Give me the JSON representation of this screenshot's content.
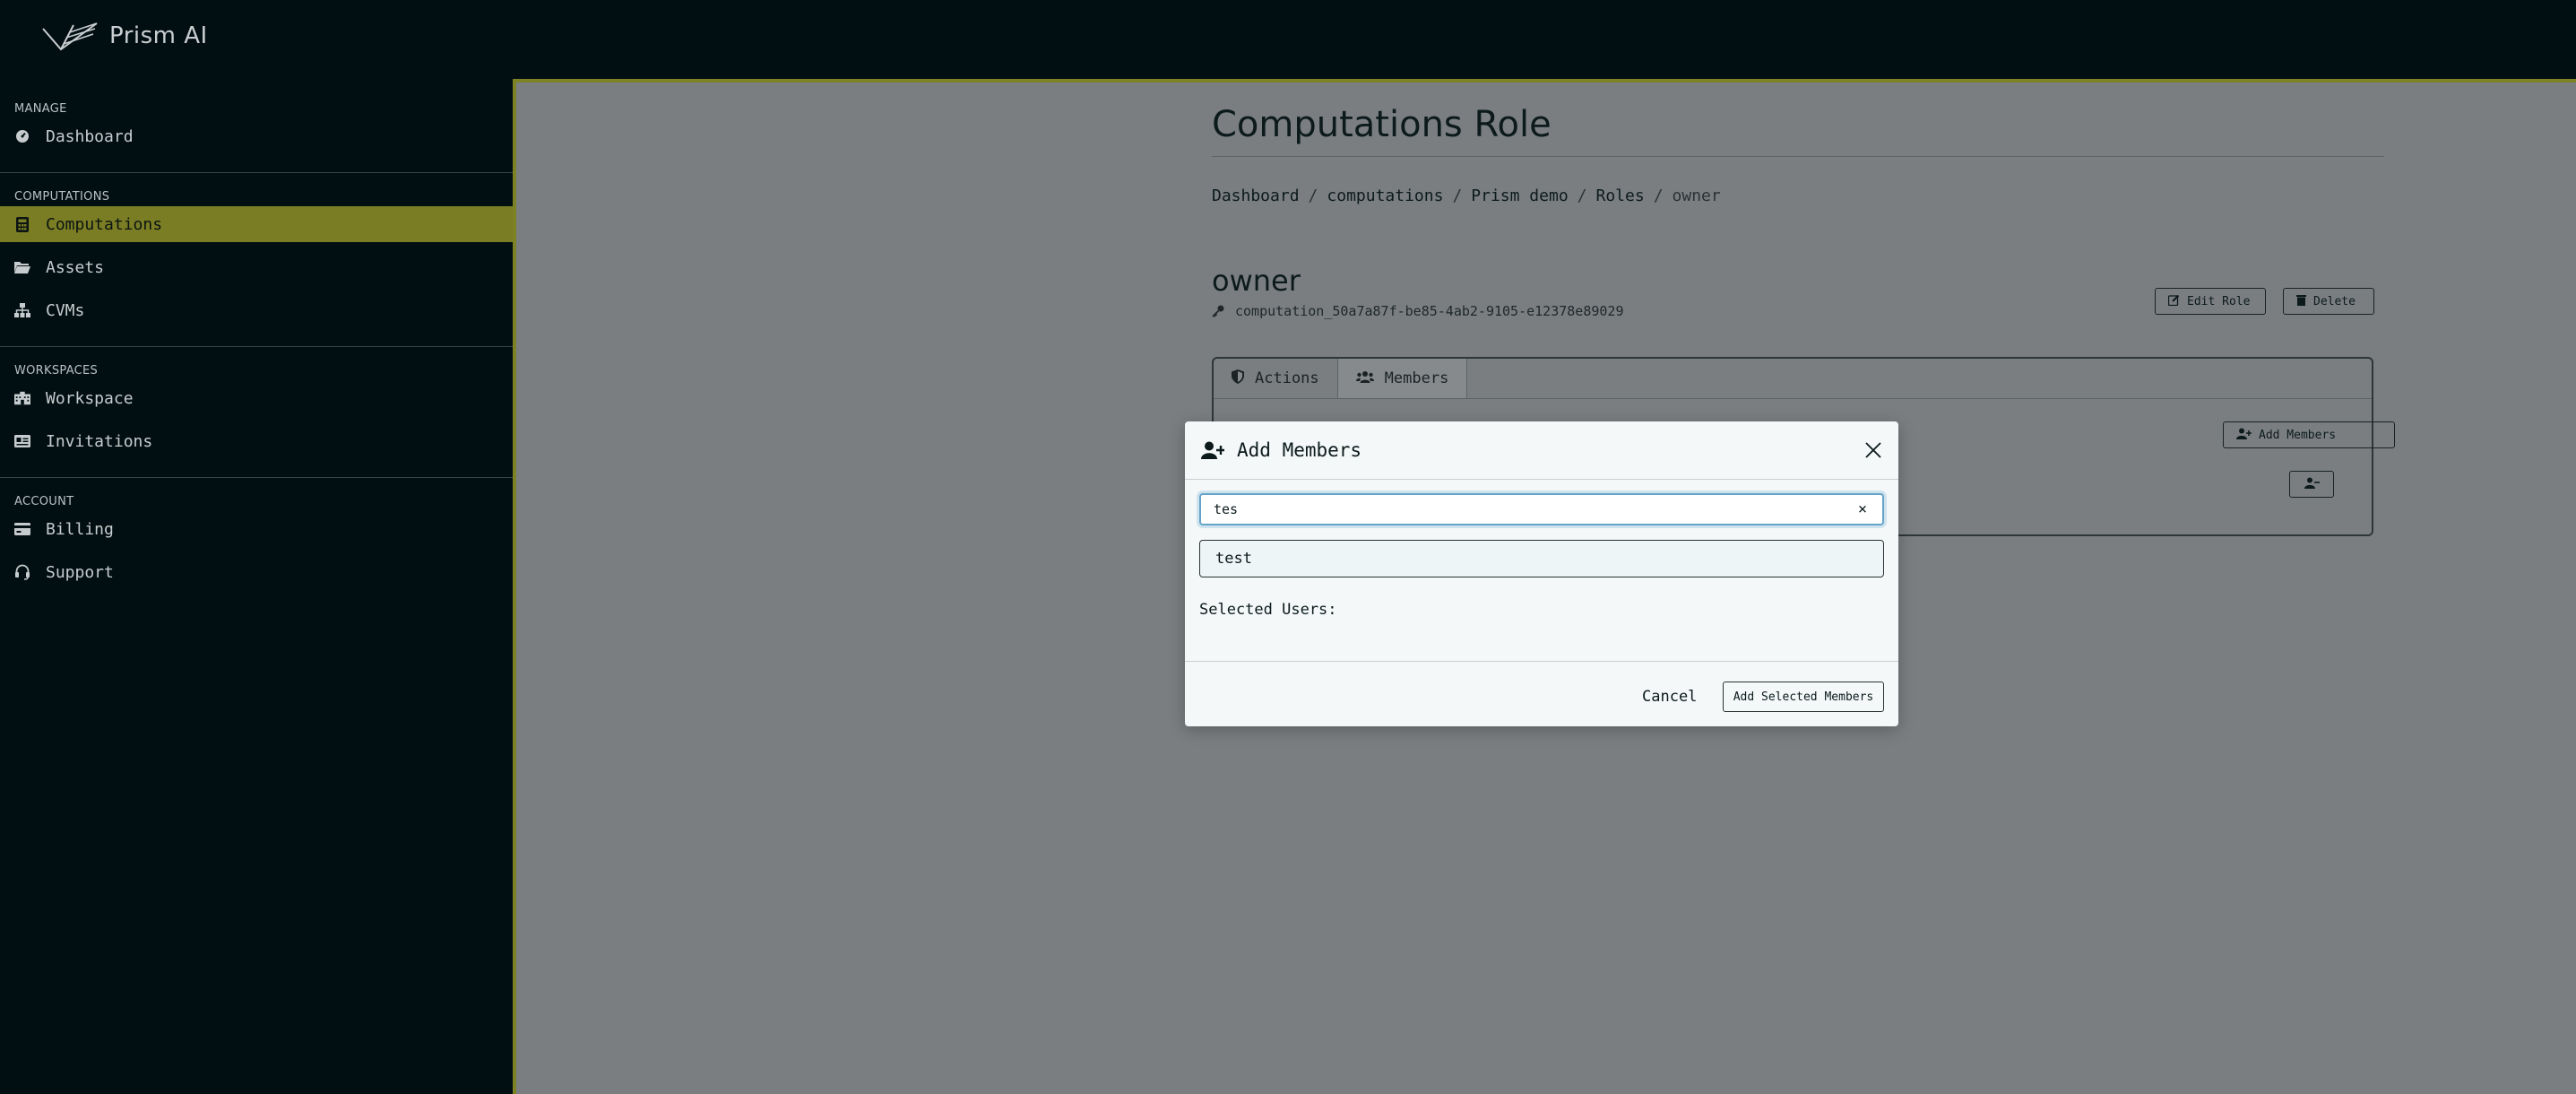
{
  "app": {
    "name": "Prism AI"
  },
  "sidebar": {
    "sections": [
      {
        "title": "MANAGE",
        "items": [
          {
            "label": "Dashboard",
            "icon": "gauge-icon",
            "active": false
          }
        ]
      },
      {
        "title": "COMPUTATIONS",
        "items": [
          {
            "label": "Computations",
            "icon": "calculator-icon",
            "active": true
          },
          {
            "label": "Assets",
            "icon": "folder-icon",
            "active": false
          },
          {
            "label": "CVMs",
            "icon": "sitemap-icon",
            "active": false
          }
        ]
      },
      {
        "title": "WORKSPACES",
        "items": [
          {
            "label": "Workspace",
            "icon": "building-icon",
            "active": false
          },
          {
            "label": "Invitations",
            "icon": "id-card-icon",
            "active": false
          }
        ]
      },
      {
        "title": "ACCOUNT",
        "items": [
          {
            "label": "Billing",
            "icon": "credit-card-icon",
            "active": false
          },
          {
            "label": "Support",
            "icon": "headset-icon",
            "active": false
          }
        ]
      }
    ]
  },
  "page": {
    "title": "Computations Role",
    "breadcrumb": [
      "Dashboard",
      "computations",
      "Prism demo",
      "Roles",
      "owner"
    ],
    "breadcrumb_sep": "/",
    "role": {
      "name": "owner",
      "id": "computation_50a7a87f-be85-4ab2-9105-e12378e89029",
      "edit_label": "Edit Role",
      "delete_label": "Delete"
    },
    "tabs": [
      {
        "label": "Actions",
        "icon": "shield-icon"
      },
      {
        "label": "Members",
        "icon": "users-icon"
      }
    ],
    "add_members_label": "Add Members"
  },
  "modal": {
    "title": "Add Members",
    "search_value": "tes",
    "clear_glyph": "×",
    "suggestions": [
      "test"
    ],
    "selected_users_label": "Selected Users:",
    "cancel_label": "Cancel",
    "add_selected_label": "Add Selected Members"
  },
  "colors": {
    "sidebar_bg": "#020f12",
    "active_item": "#7a7d24",
    "main_overlay": "#7a7e81",
    "accent_border": "#7d8224",
    "modal_bg": "#f4f8f9",
    "focus_ring": "#66a3c8"
  }
}
